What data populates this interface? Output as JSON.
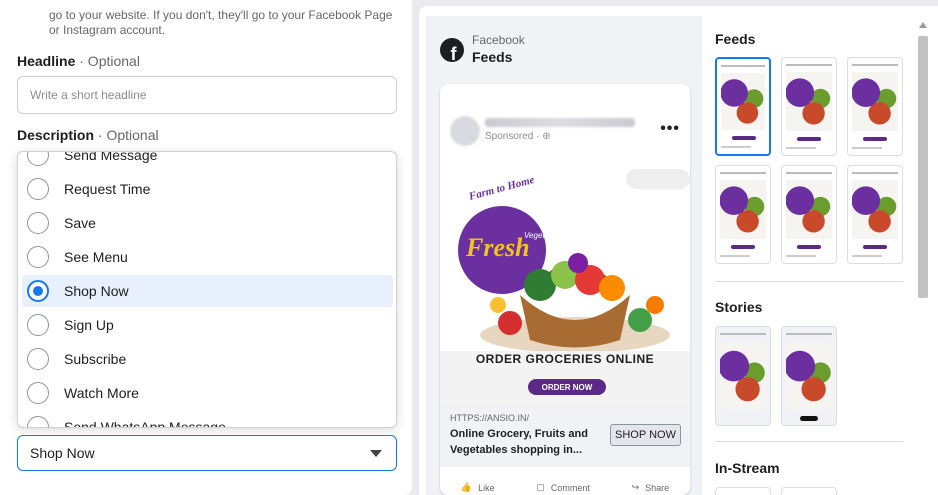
{
  "destination": {
    "helper_text": "go to your website. If you don't, they'll go to your Facebook Page or Instagram account."
  },
  "headline": {
    "label": "Headline",
    "optional": "· Optional",
    "placeholder": "Write a short headline"
  },
  "description": {
    "label": "Description",
    "optional": "· Optional"
  },
  "cta_dropdown": {
    "options": [
      {
        "label": "Send Message",
        "selected": false
      },
      {
        "label": "Request Time",
        "selected": false
      },
      {
        "label": "Save",
        "selected": false
      },
      {
        "label": "See Menu",
        "selected": false
      },
      {
        "label": "Shop Now",
        "selected": true
      },
      {
        "label": "Sign Up",
        "selected": false
      },
      {
        "label": "Subscribe",
        "selected": false
      },
      {
        "label": "Watch More",
        "selected": false
      },
      {
        "label": "Send WhatsApp Message",
        "selected": false
      }
    ],
    "selected_value": "Shop Now"
  },
  "preview": {
    "platform": "Facebook",
    "placement": "Feeds",
    "post": {
      "sponsored": "Sponsored · ",
      "creative": {
        "tagline": "Farm to Home",
        "brand_word": "Fresh",
        "subtitle": "Vegetables & Fruits",
        "headline": "ORDER GROCERIES ONLINE",
        "cta": "ORDER NOW"
      },
      "link_url": "HTTPS://ANSIO.IN/",
      "link_title": "Online Grocery, Fruits and Vegetables shopping in...",
      "cta_button": "SHOP NOW",
      "actions": {
        "like": "Like",
        "comment": "Comment",
        "share": "Share"
      }
    }
  },
  "placements": {
    "feeds_title": "Feeds",
    "stories_title": "Stories",
    "instream_title": "In-Stream"
  },
  "colors": {
    "accent": "#1877f2",
    "brand_purple": "#5b2a86",
    "selected_bg": "#e7f0fc"
  }
}
